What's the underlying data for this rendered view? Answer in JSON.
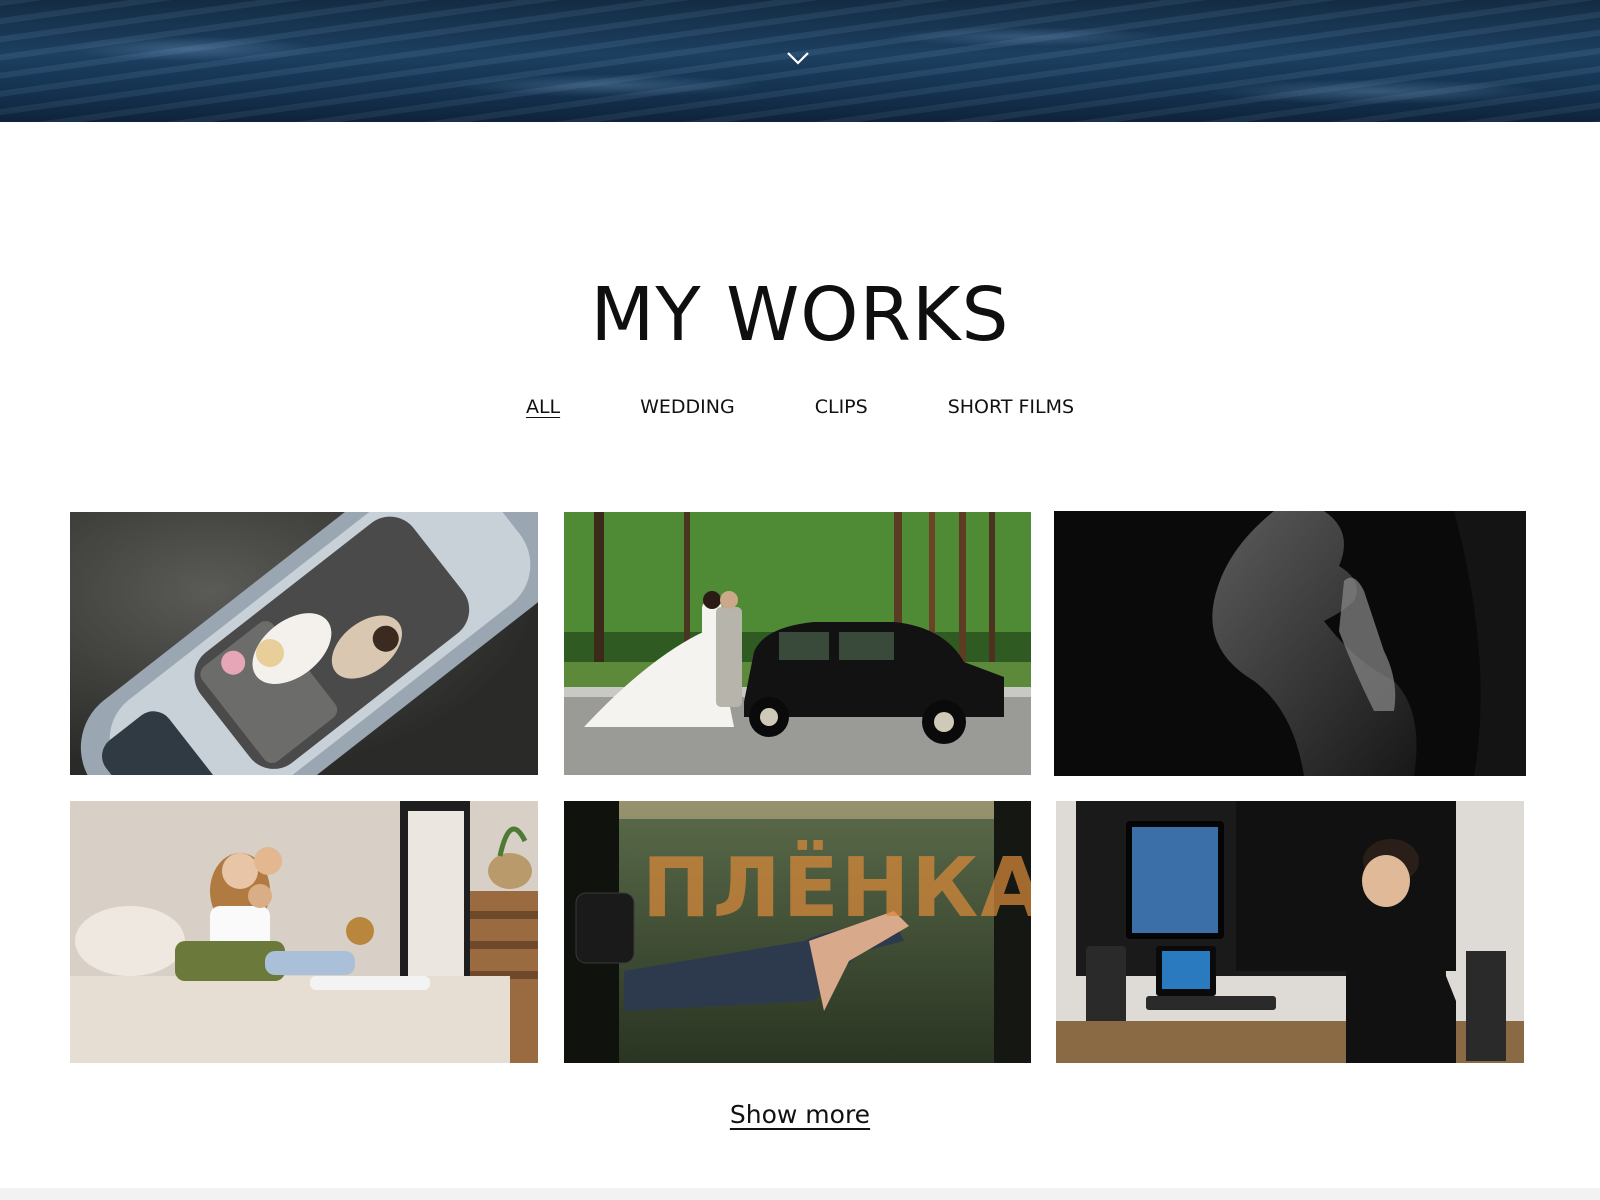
{
  "header": {
    "scroll_icon": "chevron-down-icon"
  },
  "works": {
    "title": "MY WORKS",
    "filters": [
      {
        "label": "ALL",
        "active": true
      },
      {
        "label": "WEDDING",
        "active": false
      },
      {
        "label": "CLIPS",
        "active": false
      },
      {
        "label": "SHORT FILMS",
        "active": false
      }
    ],
    "film_text": "ПЛЁНКА",
    "show_more": "Show more"
  },
  "colors": {
    "text": "#0f0f0f",
    "hero_water": "#1f4468",
    "film_text": "#d98a3a"
  }
}
